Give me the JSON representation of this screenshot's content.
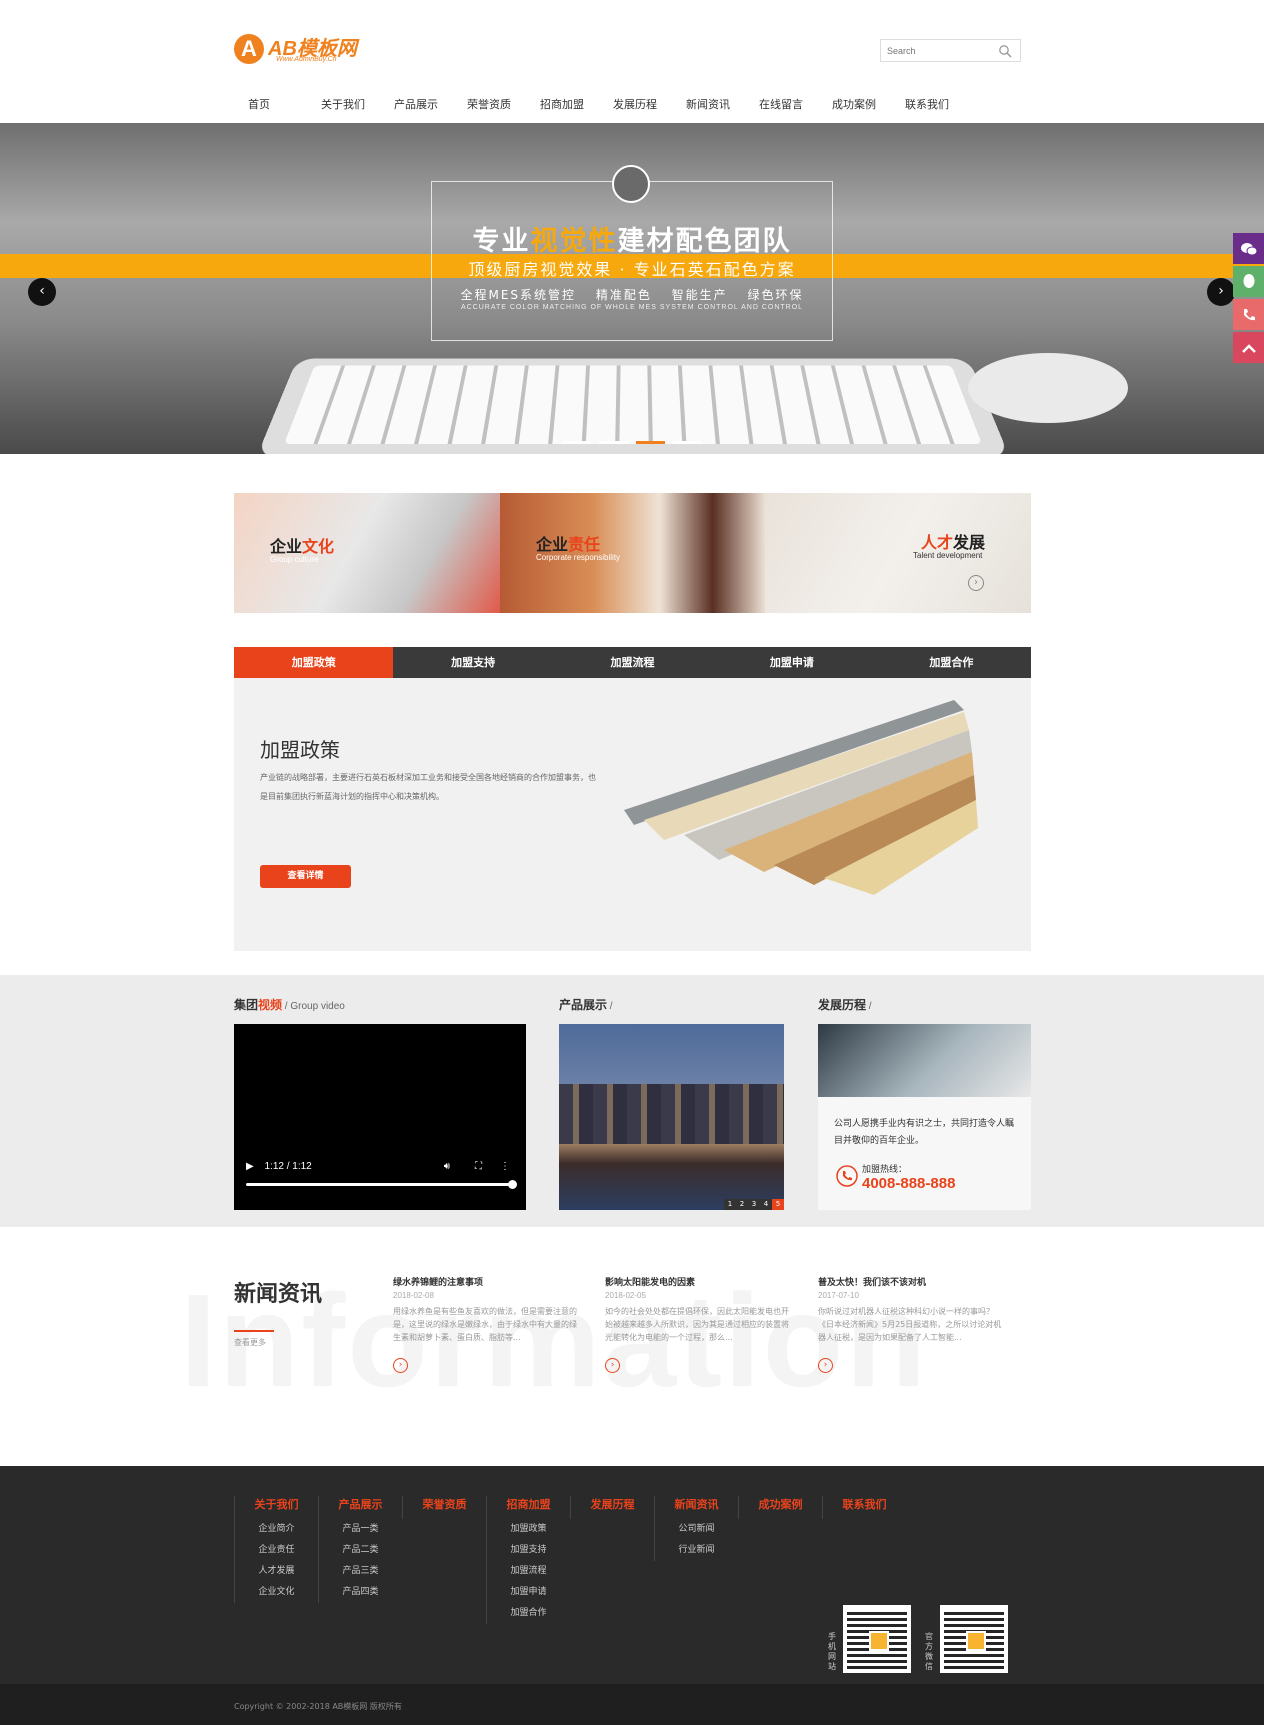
{
  "header": {
    "logo_text": "AB模板网",
    "logo_letter": "A",
    "logo_sub": "Www.AdminBuy.Cn",
    "search_placeholder": "Search",
    "nav": [
      "首页",
      "关于我们",
      "产品展示",
      "荣誉资质",
      "招商加盟",
      "发展历程",
      "新闻资讯",
      "在线留言",
      "成功案例",
      "联系我们"
    ]
  },
  "banner": {
    "title_a": "专业",
    "title_b": "视觉性",
    "title_c": "建材配色团队",
    "subtitle": "顶级厨房视觉效果 · 专业石英石配色方案",
    "line3": "全程MES系统管控　 精准配色　 智能生产　 绿色环保",
    "line4": "ACCURATE COLOR MATCHING OF WHOLE MES SYSTEM CONTROL AND CONTROL",
    "prev_icon": "chevron-left-icon",
    "next_icon": "chevron-right-icon",
    "active_slide": 3,
    "slide_count": 4
  },
  "side_tools": [
    {
      "icon": "wechat-icon",
      "color": "#6a2d8a"
    },
    {
      "icon": "qq-icon",
      "color": "#5fb06a"
    },
    {
      "icon": "phone-icon",
      "color": "#e86a6a"
    },
    {
      "icon": "back-to-top-icon",
      "color": "#d9475f"
    }
  ],
  "promos": [
    {
      "a": "企业",
      "b": "文化",
      "sub": "Group culture"
    },
    {
      "a": "企业",
      "b": "责任",
      "sub": "Corporate responsibility"
    },
    {
      "a": "人才",
      "b": "发展",
      "sub": "Talent development"
    }
  ],
  "join": {
    "tabs": [
      "加盟政策",
      "加盟支持",
      "加盟流程",
      "加盟申请",
      "加盟合作"
    ],
    "title": "加盟政策",
    "text": "产业链的战略部署，主要进行石英石板材深加工业务和接受全国各地经销商的合作加盟事务，也是目前集团执行新蓝海计划的指挥中心和决策机构。",
    "button": "查看详情"
  },
  "section3": {
    "video_title_a": "集团",
    "video_title_b": "视频",
    "video_title_sub": " / Group video",
    "video_time": "1:12 / 1:12",
    "products_title": "产品展示",
    "products_sub": " /",
    "pager": [
      "1",
      "2",
      "3",
      "4",
      "5"
    ],
    "pager_active": "5",
    "history_title": "发展历程",
    "history_sub": " /",
    "history_text": "公司人愿携手业内有识之士，共同打造令人瞩目并敬仰的百年企业。",
    "hotline_label": "加盟热线：",
    "hotline": "4008-888-888"
  },
  "news": {
    "bg_word": "Information",
    "title": "新闻资讯",
    "more": "查看更多",
    "items": [
      {
        "title": "绿水养锦鲤的注意事项",
        "date": "2018-02-08",
        "text": "用绿水养鱼是有些鱼友喜欢的做法，但是需要注意的是，这里说的绿水是嫩绿水，由于绿水中有大量的绿生素和胡萝卜素、蛋白质、脂肪等..."
      },
      {
        "title": "影响太阳能发电的因素",
        "date": "2018-02-05",
        "text": "如今的社会处处都在提倡环保，因此太阳能发电也开始被越来越多人所默识，因为其是通过相应的装置将光能转化为电能的一个过程，那么..."
      },
      {
        "title": "普及太快！我们该不该对机",
        "date": "2017-07-10",
        "text": "你听说过对机器人征税这种科幻小说一样的事吗？《日本经济新闻》5月25日报道称，之所以讨论对机器人征税，是因为如果配备了人工智能..."
      }
    ]
  },
  "footer": {
    "columns": [
      {
        "head": "关于我们",
        "items": [
          "企业简介",
          "企业责任",
          "人才发展",
          "企业文化"
        ]
      },
      {
        "head": "产品展示",
        "items": [
          "产品一类",
          "产品二类",
          "产品三类",
          "产品四类"
        ]
      },
      {
        "head": "荣誉资质",
        "items": []
      },
      {
        "head": "招商加盟",
        "items": [
          "加盟政策",
          "加盟支持",
          "加盟流程",
          "加盟申请",
          "加盟合作"
        ]
      },
      {
        "head": "发展历程",
        "items": []
      },
      {
        "head": "新闻资讯",
        "items": [
          "公司新闻",
          "行业新闻"
        ]
      },
      {
        "head": "成功案例",
        "items": []
      },
      {
        "head": "联系我们",
        "items": []
      }
    ],
    "qr1_label": "手机网站",
    "qr2_label": "官方微信",
    "copyright": "Copyright © 2002-2018 AB模板网 版权所有"
  },
  "colors": {
    "accent": "#e9431c",
    "banner_stripe": "#f7a80c",
    "logo": "#f0811f",
    "footer_bg": "#2a2a2a"
  }
}
